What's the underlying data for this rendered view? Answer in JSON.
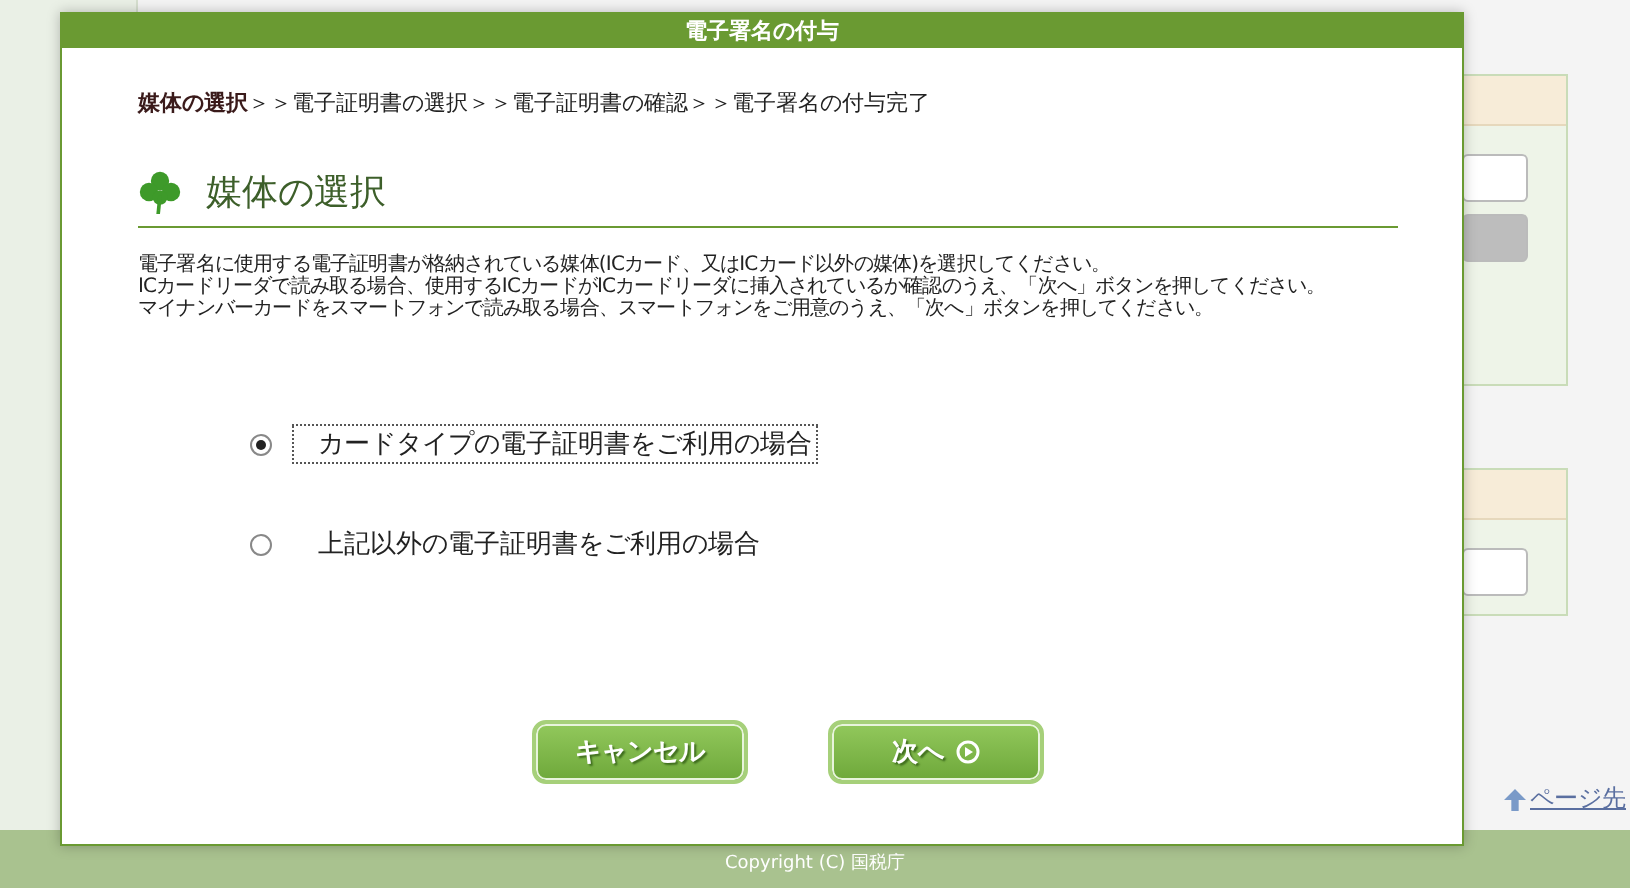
{
  "background_page": {
    "page_top_link": "ページ先"
  },
  "dialog": {
    "title": "電子署名の付与",
    "breadcrumb": [
      {
        "label": "媒体の選択",
        "selected": true
      },
      {
        "label": "＞＞電子証明書の選択",
        "selected": false
      },
      {
        "label": "＞＞電子証明書の確認",
        "selected": false
      },
      {
        "label": "＞＞電子署名の付与完了",
        "selected": false
      }
    ],
    "heading": "媒体の選択",
    "instructions": [
      "電子署名に使用する電子証明書が格納されている媒体(ICカード、又はICカード以外の媒体)を選択してください。",
      "ICカードリーダで読み取る場合、使用するICカードがICカードリーダに挿入されているか確認のうえ、「次へ」ボタンを押してください。",
      "マイナンバーカードをスマートフォンで読み取る場合、スマートフォンをご用意のうえ、「次へ」ボタンを押してください。"
    ],
    "options": [
      {
        "label": "カードタイプの電子証明書をご利用の場合",
        "selected": true
      },
      {
        "label": "上記以外の電子証明書をご利用の場合",
        "selected": false
      }
    ],
    "buttons": [
      {
        "label": "キャンセル",
        "kind": "cancel"
      },
      {
        "label": "次へ",
        "kind": "next"
      }
    ]
  },
  "footer": {
    "copyright": "Copyright (C) 国税庁"
  }
}
